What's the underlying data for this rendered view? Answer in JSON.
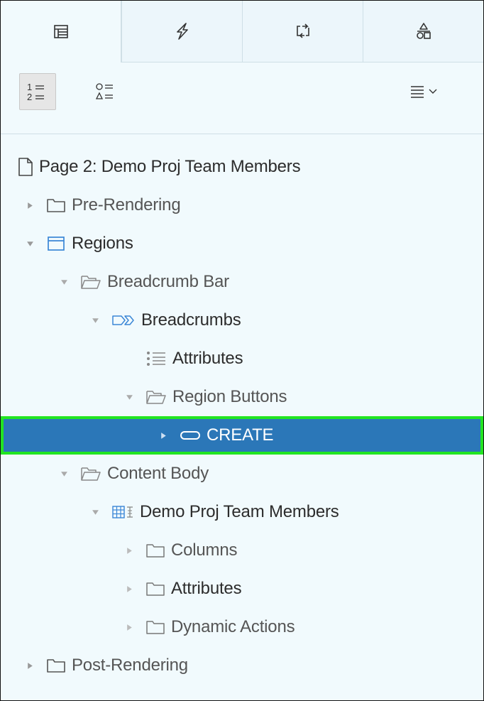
{
  "tabs": [
    {
      "icon": "rendering-tree-icon",
      "active": true
    },
    {
      "icon": "lightning-dynamic-actions-icon",
      "active": false
    },
    {
      "icon": "processing-arrows-icon",
      "active": false
    },
    {
      "icon": "shared-components-shapes-icon",
      "active": false
    }
  ],
  "toolbar": {
    "grouped_view": {
      "top": "1",
      "bottom": "2",
      "icon": "numbered-list-icon"
    },
    "flat_view": {
      "icon": "shapes-list-icon"
    },
    "menu": {
      "icon": "hamburger-chevron-icon"
    }
  },
  "tree": {
    "page": {
      "label": "Page 2: Demo Proj Team Members",
      "icon": "page-icon"
    },
    "pre_rendering": {
      "label": "Pre-Rendering",
      "icon": "folder-icon"
    },
    "regions": {
      "label": "Regions",
      "icon": "region-icon"
    },
    "breadcrumb_bar": {
      "label": "Breadcrumb Bar",
      "icon": "folder-open-icon"
    },
    "breadcrumbs": {
      "label": "Breadcrumbs",
      "icon": "breadcrumb-icon"
    },
    "breadcrumbs_attributes": {
      "label": "Attributes",
      "icon": "attributes-list-icon"
    },
    "region_buttons": {
      "label": "Region Buttons",
      "icon": "folder-open-icon"
    },
    "create": {
      "label": "CREATE",
      "icon": "button-pill-icon",
      "selected": true
    },
    "content_body": {
      "label": "Content Body",
      "icon": "folder-open-icon"
    },
    "demo_proj_team_members": {
      "label": "Demo Proj Team Members",
      "icon": "interactive-grid-icon"
    },
    "columns": {
      "label": "Columns",
      "icon": "folder-icon"
    },
    "attributes": {
      "label": "Attributes",
      "icon": "folder-icon"
    },
    "dynamic_actions": {
      "label": "Dynamic Actions",
      "icon": "folder-icon"
    },
    "post_rendering": {
      "label": "Post-Rendering",
      "icon": "folder-icon"
    }
  },
  "colors": {
    "selected_row": "#2b77b8",
    "selection_outline": "#22e522",
    "panel_bg": "#f1fafd",
    "region_icon": "#3a86d6"
  }
}
